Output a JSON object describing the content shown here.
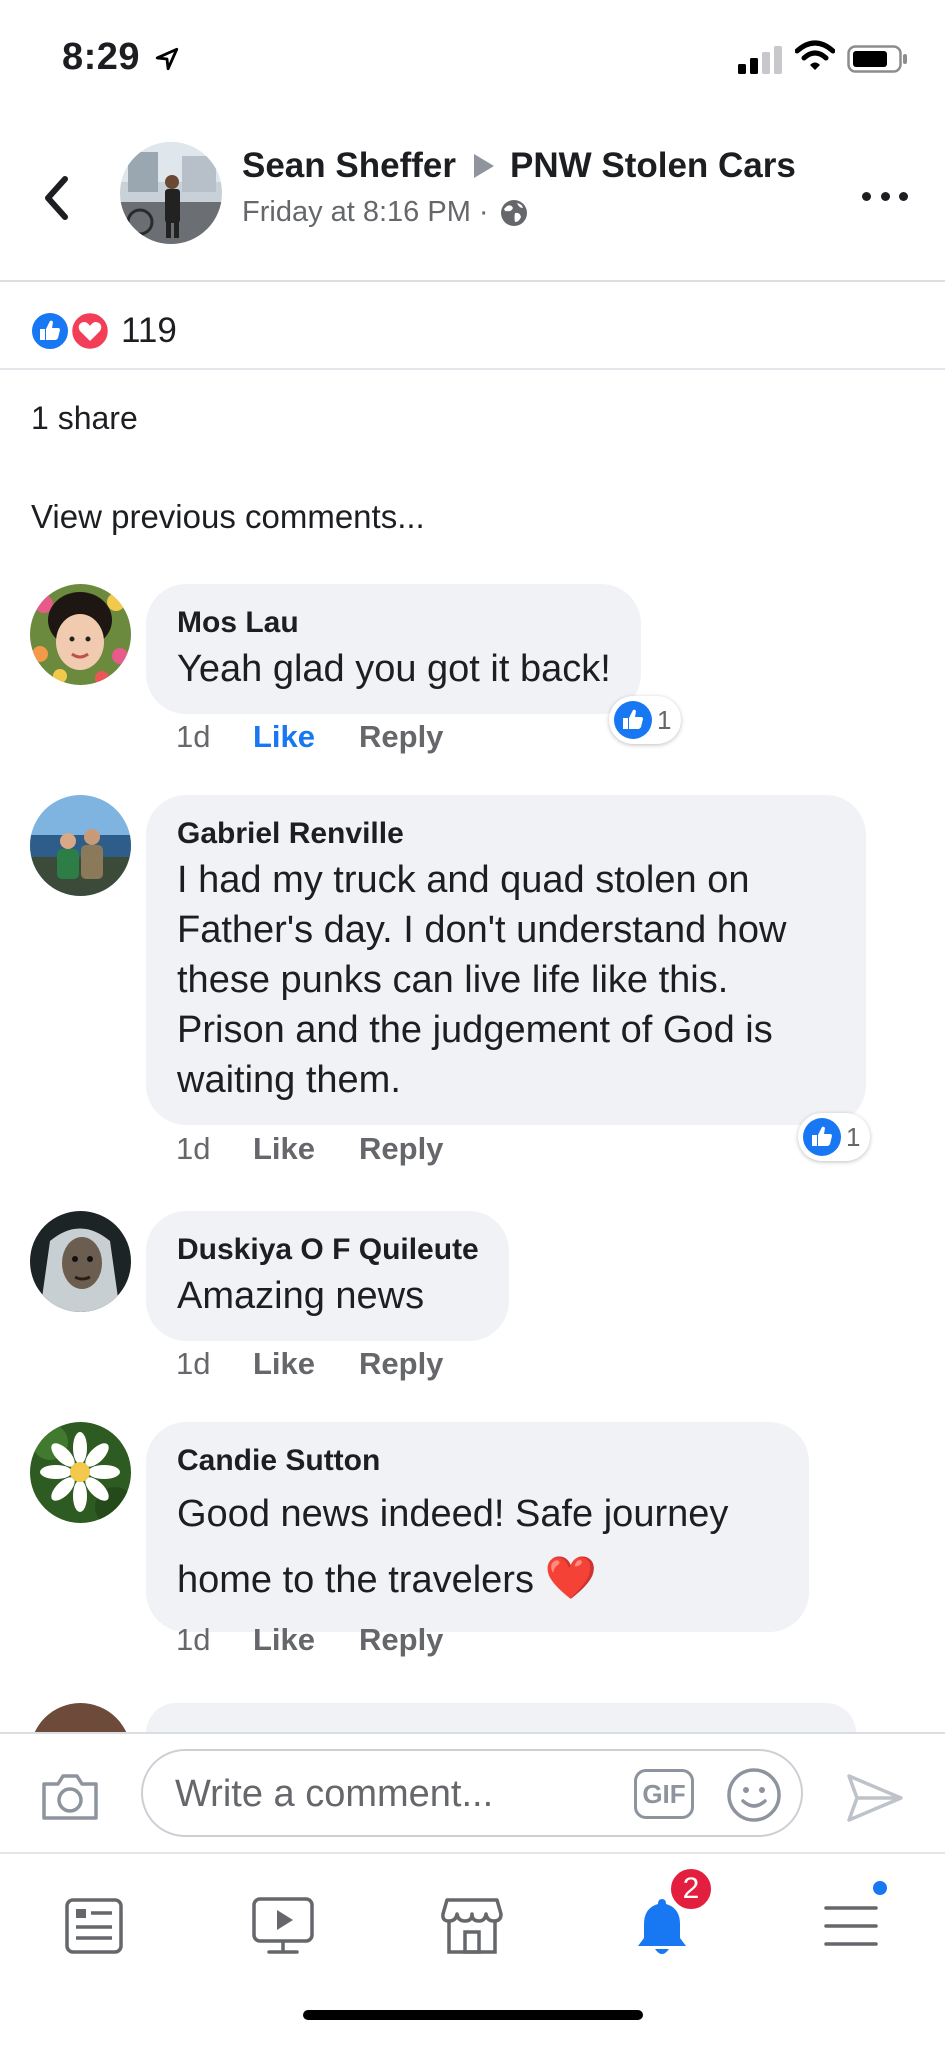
{
  "status": {
    "time": "8:29"
  },
  "header": {
    "author": "Sean Sheffer",
    "group": "PNW Stolen Cars",
    "timestamp": "Friday at 8:16 PM",
    "separator": "·"
  },
  "reactions": {
    "count": "119",
    "types": [
      "like",
      "love"
    ]
  },
  "shares_label": "1 share",
  "view_previous_label": "View previous comments...",
  "comments": [
    {
      "author": "Mos Lau",
      "text": "Yeah glad you got it back!",
      "time": "1d",
      "like": "Like",
      "reply": "Reply",
      "likes": "1",
      "liked": true
    },
    {
      "author": "Gabriel Renville",
      "text": "I had my truck and quad stolen on Father's day. I don't understand how these punks can live life like this. Prison and the judgement of God is waiting them.",
      "time": "1d",
      "like": "Like",
      "reply": "Reply",
      "likes": "1"
    },
    {
      "author": "Duskiya O F Quileute",
      "text": "Amazing news",
      "time": "1d",
      "like": "Like",
      "reply": "Reply"
    },
    {
      "author": "Candie Sutton",
      "text": "Good news indeed!  Safe journey home to the travelers",
      "emoji": "❤️",
      "time": "1d",
      "like": "Like",
      "reply": "Reply"
    }
  ],
  "composer": {
    "placeholder": "Write a comment...",
    "gif_label": "GIF"
  },
  "tabbar": {
    "items": [
      "news-feed",
      "watch",
      "marketplace",
      "notifications",
      "menu"
    ],
    "notifications_badge": "2"
  },
  "colors": {
    "accent": "#1877f2",
    "love": "#f33e58",
    "badge": "#e41e3f",
    "bubble": "#f0f2f5"
  }
}
